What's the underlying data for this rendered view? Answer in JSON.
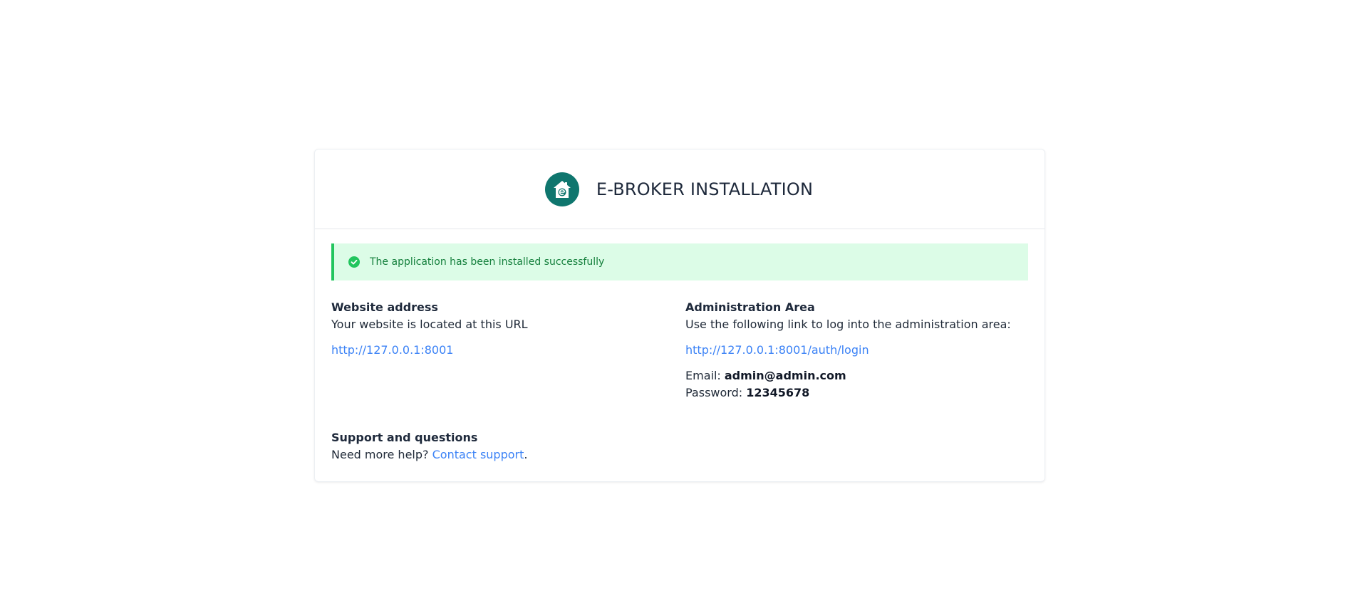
{
  "header": {
    "title": "E-BROKER INSTALLATION",
    "logo_icon": "house-e-logo-icon",
    "logo_color": "#0f766e"
  },
  "alert": {
    "message": "The application has been installed successfully",
    "icon": "check-circle-icon",
    "color": "#22c55e"
  },
  "website": {
    "heading": "Website address",
    "description": "Your website is located at this URL",
    "url": "http://127.0.0.1:8001"
  },
  "admin": {
    "heading": "Administration Area",
    "description": "Use the following link to log into the administration area:",
    "url": "http://127.0.0.1:8001/auth/login",
    "email_label": "Email:",
    "email_value": "admin@admin.com",
    "password_label": "Password:",
    "password_value": "12345678"
  },
  "support": {
    "heading": "Support and questions",
    "prefix": "Need more help?",
    "link_label": "Contact support",
    "suffix": "."
  }
}
